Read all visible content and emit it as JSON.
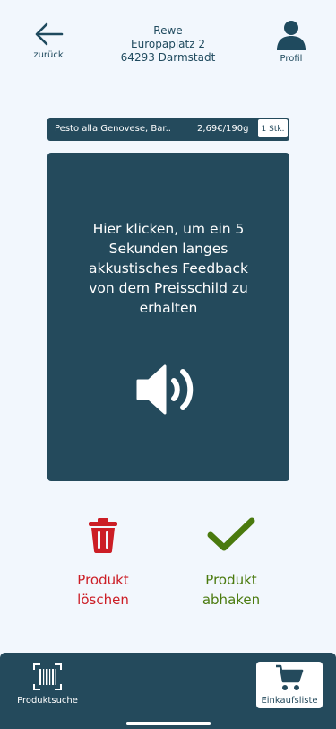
{
  "header": {
    "back_label": "zurück",
    "store_name": "Rewe",
    "store_street": "Europaplatz 2",
    "store_city": "64293 Darmstadt",
    "profile_label": "Profil",
    "icons": {
      "back": "arrow-left-icon",
      "profile": "user-icon"
    }
  },
  "product": {
    "name": "Pesto alla Genovese, Bar..",
    "price": "2,69€/190g",
    "quantity": "1 Stk."
  },
  "feedback": {
    "text": "Hier klicken, um ein 5 Sekunden langes akkustisches Feedback von dem Preisschild zu erhalten",
    "icon": "speaker-icon"
  },
  "actions": {
    "delete_label": "Produkt\nlöschen",
    "check_label": "Produkt\nabhaken",
    "icons": {
      "delete": "trash-icon",
      "check": "checkmark-icon"
    }
  },
  "bottom_nav": {
    "search_label": "Produktsuche",
    "cart_label": "Einkaufsliste",
    "icons": {
      "search": "barcode-scan-icon",
      "cart": "shopping-cart-icon"
    }
  },
  "colors": {
    "primary": "#244a5c",
    "background": "#f2f7fd",
    "delete": "#cc1e26",
    "check": "#4a7a0e"
  }
}
